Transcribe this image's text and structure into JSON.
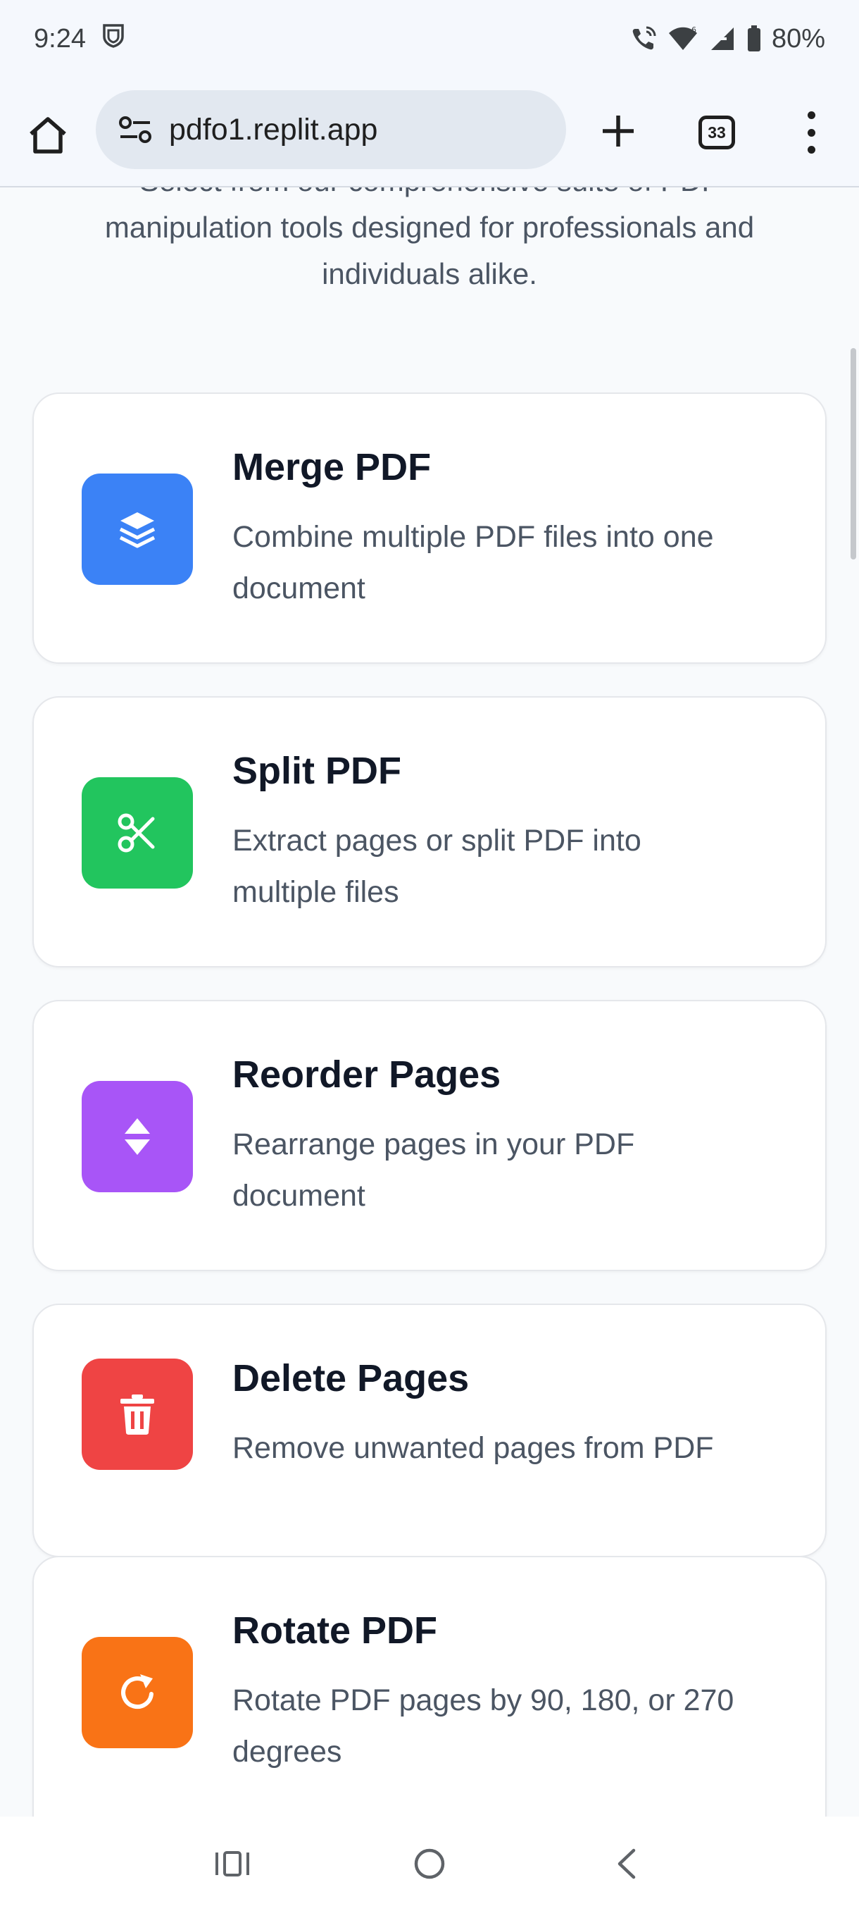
{
  "status_bar": {
    "time": "9:24",
    "battery": "80%"
  },
  "browser": {
    "url": "pdfo1.replit.app",
    "tab_count": "33"
  },
  "intro": {
    "line1": "Select from our comprehensive suite of PDF",
    "line2": "manipulation tools designed for professionals and",
    "line3": "individuals alike."
  },
  "tools": [
    {
      "title": "Merge PDF",
      "line1": "Combine multiple PDF files into one",
      "line2": "document",
      "icon": "layers-icon",
      "color": "#3b82f6"
    },
    {
      "title": "Split PDF",
      "line1": "Extract pages or split PDF into",
      "line2": "multiple files",
      "icon": "scissors-icon",
      "color": "#22c55e"
    },
    {
      "title": "Reorder Pages",
      "line1": "Rearrange pages in your PDF",
      "line2": "document",
      "icon": "sort-icon",
      "color": "#a855f7"
    },
    {
      "title": "Delete Pages",
      "line1": "Remove unwanted pages from PDF",
      "line2": "",
      "icon": "trash-icon",
      "color": "#ef4444"
    },
    {
      "title": "Rotate PDF",
      "line1": "Rotate PDF pages by 90, 180, or 270",
      "line2": "degrees",
      "icon": "rotate-icon",
      "color": "#f97316"
    }
  ]
}
